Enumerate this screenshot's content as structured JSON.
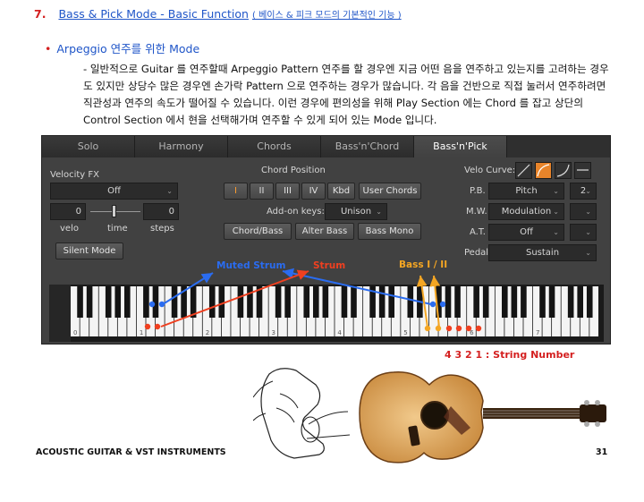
{
  "section": {
    "number": "7.",
    "title": "Bass & Pick Mode - Basic Function",
    "subtitle": "( 베이스 & 피크 모드의 기본적인 기능 )"
  },
  "bullet": {
    "title": "Arpeggio 연주를 위한 Mode"
  },
  "body": {
    "dash": "-",
    "text": "일반적으로 Guitar 를 연주할때 Arpeggio Pattern 연주를 할 경우엔 지금 어떤 음을 연주하고 있는지를 고려하는 경우도 있지만 상당수 많은 경우엔 손가락 Pattern 으로 연주하는 경우가 많습니다. 각 음을 건반으로 직접 눌러서 연주하려면 직관성과 연주의 속도가 떨어질 수 있습니다. 이런 경우에 편의성을 위해 Play Section 에는 Chord 를 잡고 상단의 Control Section 에서 현을 선택해가며 연주할 수 있게 되어 있는 Mode 입니다."
  },
  "plugin": {
    "tabs": [
      "Solo",
      "Harmony",
      "Chords",
      "Bass'n'Chord",
      "Bass'n'Pick"
    ],
    "active_tab": "Bass'n'Pick",
    "velocity_fx": {
      "label": "Velocity FX",
      "mode": "Off",
      "velo_value": "0",
      "steps_value": "0",
      "velo_label": "velo",
      "time_label": "time",
      "steps_label": "steps",
      "silent_mode": "Silent Mode"
    },
    "chord_position": {
      "label": "Chord Position",
      "buttons": [
        "I",
        "II",
        "III",
        "IV",
        "Kbd"
      ],
      "active": "I",
      "user_chords": "User Chords",
      "addon_label": "Add-on keys:",
      "addon_value": "Unison",
      "mode_buttons": [
        "Chord/Bass",
        "Alter Bass",
        "Bass Mono"
      ]
    },
    "right": {
      "velo_curve_label": "Velo Curve:",
      "pb_label": "P.B.",
      "pb_value": "Pitch",
      "pb_range": "2",
      "mw_label": "M.W.",
      "mw_value": "Modulation",
      "at_label": "A.T.",
      "at_value": "Off",
      "pedal_label": "Pedal",
      "pedal_value": "Sustain"
    },
    "octave_labels": [
      "0",
      "1",
      "2",
      "3",
      "4",
      "5",
      "6",
      "7"
    ]
  },
  "annotations": {
    "muted_strum": "Muted Strum",
    "strum": "Strum",
    "bass": "Bass I / II",
    "string_number": "4 3 2 1 : String Number"
  },
  "colors": {
    "muted_strum": "#2a6cf0",
    "strum": "#f04020",
    "bass": "#f5a623",
    "heading_blue": "#1f55c8",
    "heading_red": "#d42020"
  },
  "footer": {
    "left": "ACOUSTIC GUITAR & VST INSTRUMENTS",
    "page": "31"
  }
}
